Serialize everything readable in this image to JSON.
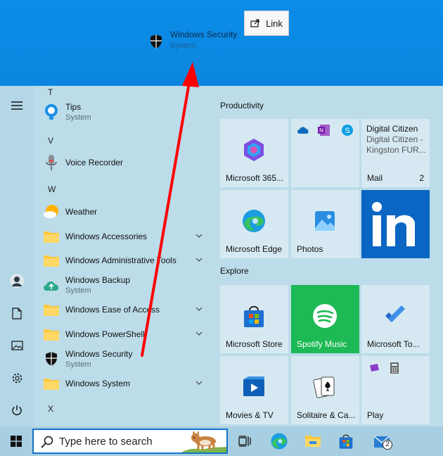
{
  "drag_ghost": {
    "title": "Windows Security",
    "subtitle": "System"
  },
  "link_tooltip": {
    "label": "Link"
  },
  "app_list": {
    "letters": {
      "t": "T",
      "v": "V",
      "w": "W",
      "x": "X"
    },
    "items": [
      {
        "name": "Tips",
        "subtitle": "System",
        "icon": "tips-icon"
      },
      {
        "name": "Voice Recorder",
        "subtitle": "",
        "icon": "microphone-icon"
      },
      {
        "name": "Weather",
        "subtitle": "",
        "icon": "weather-icon"
      },
      {
        "name": "Windows Accessories",
        "subtitle": "",
        "icon": "folder-icon",
        "expandable": true
      },
      {
        "name": "Windows Administrative Tools",
        "subtitle": "",
        "icon": "folder-icon",
        "expandable": true
      },
      {
        "name": "Windows Backup",
        "subtitle": "System",
        "icon": "cloud-backup-icon"
      },
      {
        "name": "Windows Ease of Access",
        "subtitle": "",
        "icon": "folder-icon",
        "expandable": true
      },
      {
        "name": "Windows PowerShell",
        "subtitle": "",
        "icon": "folder-icon",
        "expandable": true
      },
      {
        "name": "Windows Security",
        "subtitle": "System",
        "icon": "shield-icon"
      },
      {
        "name": "Windows System",
        "subtitle": "",
        "icon": "folder-icon",
        "expandable": true
      }
    ]
  },
  "groups": {
    "productivity": "Productivity",
    "explore": "Explore"
  },
  "tiles": {
    "microsoft365": "Microsoft 365...",
    "mail": {
      "label": "Mail",
      "badge": "2",
      "from": "Digital Citizen",
      "preview": "Digital Citizen - Kingston FUR..."
    },
    "edge": "Microsoft Edge",
    "photos": "Photos",
    "store": "Microsoft Store",
    "spotify": "Spotify Music",
    "todo": "Microsoft To...",
    "movies": "Movies & TV",
    "solitaire": "Solitaire & Ca...",
    "play": "Play"
  },
  "taskbar": {
    "search_placeholder": "Type here to search",
    "mail_badge": "2"
  },
  "colors": {
    "accent": "#0078d7",
    "linkedin": "#0a66c2",
    "spotify": "#1db954",
    "arrow": "#ff0000"
  }
}
